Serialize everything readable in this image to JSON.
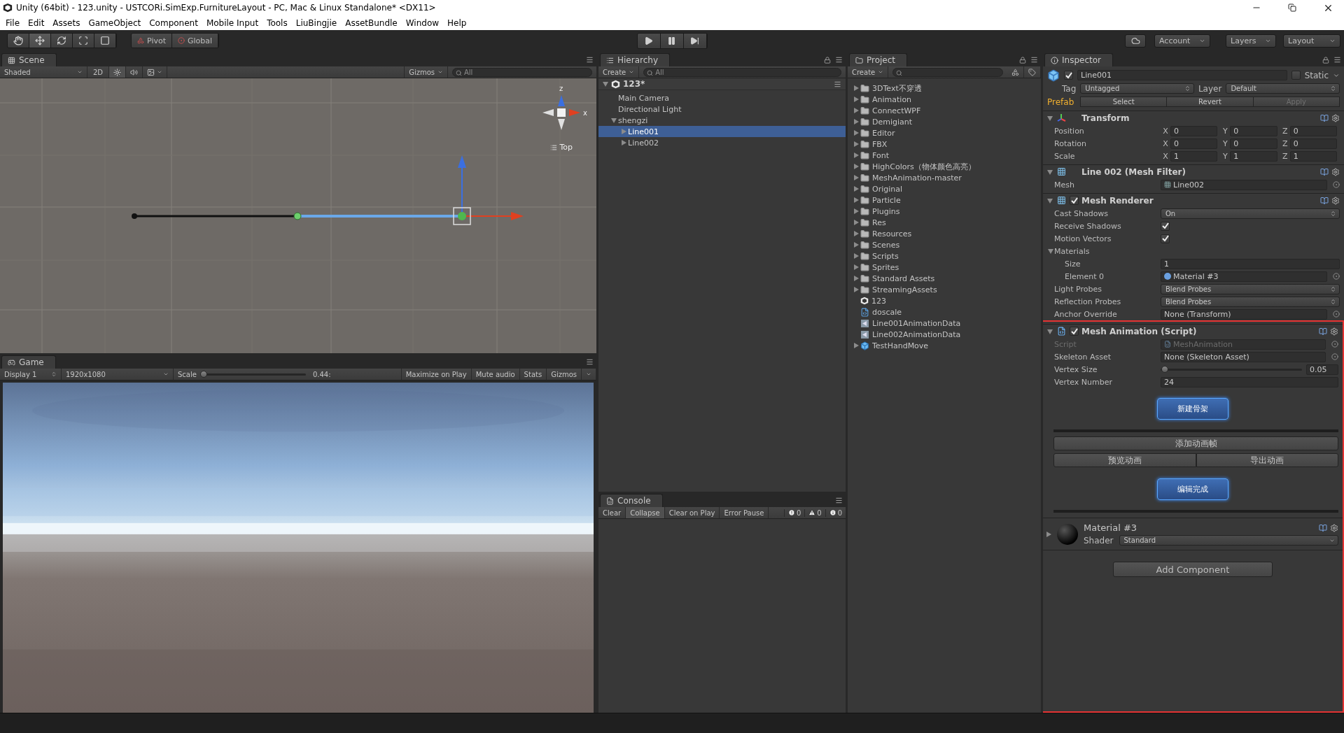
{
  "window": {
    "title": "Unity (64bit) - 123.unity - USTCORi.SimExp.FurnitureLayout - PC, Mac & Linux Standalone* <DX11>"
  },
  "menu": [
    "File",
    "Edit",
    "Assets",
    "GameObject",
    "Component",
    "Mobile Input",
    "Tools",
    "LiuBingjie",
    "AssetBundle",
    "Window",
    "Help"
  ],
  "toolbar": {
    "tools": [
      {
        "kind": "hand",
        "selected": false
      },
      {
        "kind": "move",
        "selected": true
      },
      {
        "kind": "rotate",
        "selected": false
      },
      {
        "kind": "scale",
        "selected": false
      },
      {
        "kind": "rect",
        "selected": false
      }
    ],
    "pivot": "Pivot",
    "global": "Global",
    "playback": [
      {
        "kind": "play"
      },
      {
        "kind": "pause"
      },
      {
        "kind": "step"
      }
    ],
    "account": "Account",
    "layers": "Layers",
    "layout": "Layout"
  },
  "scene": {
    "tab": "Scene",
    "shading": "Shaded",
    "mode": "2D",
    "lighting_on": true,
    "audio_on": false,
    "gizmos": "Gizmos",
    "placeholder": "All",
    "axis_labels": [
      "z",
      "x"
    ],
    "view": "Top"
  },
  "game": {
    "tab": "Game",
    "display": "Display 1",
    "resolution": "1920x1080",
    "scale_label": "Scale",
    "scale": {
      "level": 0.02
    },
    "scale_value": "0.44:",
    "options": [
      "Maximize on Play",
      "Mute audio",
      "Stats",
      "Gizmos"
    ]
  },
  "hierarchy": {
    "tab": "Hierarchy",
    "create": "Create",
    "placeholder": "All",
    "scene": "123*",
    "items": [
      {
        "label": "Main Camera",
        "selected": false
      },
      {
        "label": "Directional Light",
        "selected": false
      },
      {
        "label": "shengzi",
        "selected": false,
        "expanded": true,
        "children": [
          {
            "label": "Line001",
            "selected": true,
            "expanded": false
          },
          {
            "label": "Line002",
            "selected": false,
            "expanded": false
          }
        ]
      }
    ]
  },
  "project": {
    "tab": "Project",
    "create": "Create",
    "items": [
      {
        "kind": "folder",
        "label": "3DText不穿透",
        "expanded": false
      },
      {
        "kind": "folder",
        "label": "Animation",
        "expanded": false
      },
      {
        "kind": "folder",
        "label": "ConnectWPF",
        "expanded": false
      },
      {
        "kind": "folder",
        "label": "Demigiant",
        "expanded": false
      },
      {
        "kind": "folder",
        "label": "Editor",
        "expanded": false
      },
      {
        "kind": "folder",
        "label": "FBX",
        "expanded": false
      },
      {
        "kind": "folder",
        "label": "Font",
        "expanded": false
      },
      {
        "kind": "folder",
        "label": "HighColors（物体颜色高亮）",
        "expanded": false
      },
      {
        "kind": "folder",
        "label": "MeshAnimation-master",
        "expanded": false
      },
      {
        "kind": "folder",
        "label": "Original",
        "expanded": false
      },
      {
        "kind": "folder",
        "label": "Particle",
        "expanded": false
      },
      {
        "kind": "folder",
        "label": "Plugins",
        "expanded": false
      },
      {
        "kind": "folder",
        "label": "Res",
        "expanded": false
      },
      {
        "kind": "folder",
        "label": "Resources",
        "expanded": false
      },
      {
        "kind": "folder",
        "label": "Scenes",
        "expanded": false
      },
      {
        "kind": "folder",
        "label": "Scripts",
        "expanded": false
      },
      {
        "kind": "folder",
        "label": "Sprites",
        "expanded": false
      },
      {
        "kind": "folder",
        "label": "Standard Assets",
        "expanded": false
      },
      {
        "kind": "folder",
        "label": "StreamingAssets",
        "expanded": false
      },
      {
        "kind": "scene",
        "label": "123"
      },
      {
        "kind": "script",
        "label": "doscale"
      },
      {
        "kind": "asset",
        "label": "Line001AnimationData"
      },
      {
        "kind": "asset",
        "label": "Line002AnimationData"
      },
      {
        "kind": "prefab",
        "label": "TestHandMove",
        "expanded": false
      }
    ]
  },
  "console": {
    "tab": "Console",
    "buttons": [
      {
        "label": "Clear",
        "selected": false
      },
      {
        "label": "Collapse",
        "selected": true
      },
      {
        "label": "Clear on Play",
        "selected": false
      },
      {
        "label": "Error Pause",
        "selected": false
      }
    ],
    "counts": [
      {
        "kind": "error",
        "count": "0"
      },
      {
        "kind": "warning",
        "count": "0"
      },
      {
        "kind": "info",
        "count": "0"
      }
    ]
  },
  "inspector": {
    "tab": "Inspector",
    "object": {
      "active": true,
      "name": "Line001",
      "static_label": "Static",
      "static": false,
      "tag_label": "Tag",
      "tag": "Untagged",
      "layer_label": "Layer",
      "layer": "Default",
      "prefab_label": "Prefab",
      "prefab_buttons": [
        {
          "label": "Select",
          "disabled": false
        },
        {
          "label": "Revert",
          "disabled": false
        },
        {
          "label": "Apply",
          "disabled": true
        }
      ]
    },
    "components": [
      {
        "kind": "transform",
        "title": "Transform",
        "expanded": true,
        "highlighted": false,
        "rows": [
          {
            "kind": "vector3",
            "label": "Position",
            "values": [
              {
                "axis": "X",
                "value": "0"
              },
              {
                "axis": "Y",
                "value": "0"
              },
              {
                "axis": "Z",
                "value": "0"
              }
            ]
          },
          {
            "kind": "vector3",
            "label": "Rotation",
            "values": [
              {
                "axis": "X",
                "value": "0"
              },
              {
                "axis": "Y",
                "value": "0"
              },
              {
                "axis": "Z",
                "value": "0"
              }
            ]
          },
          {
            "kind": "vector3",
            "label": "Scale",
            "values": [
              {
                "axis": "X",
                "value": "1"
              },
              {
                "axis": "Y",
                "value": "1"
              },
              {
                "axis": "Z",
                "value": "1"
              }
            ]
          }
        ]
      },
      {
        "kind": "mesh_filter",
        "title": "Line 002 (Mesh Filter)",
        "expanded": true,
        "highlighted": false,
        "rows": [
          {
            "kind": "mesh_object",
            "label": "Mesh",
            "value": "Line002"
          }
        ]
      },
      {
        "kind": "mesh_renderer",
        "title": "Mesh Renderer",
        "enabled": true,
        "expanded": true,
        "highlighted": false,
        "rows": [
          {
            "kind": "dropdown",
            "label": "Cast Shadows",
            "value": "On"
          },
          {
            "kind": "checkbox",
            "label": "Receive Shadows",
            "checked": true
          },
          {
            "kind": "checkbox",
            "label": "Motion Vectors",
            "checked": true
          },
          {
            "kind": "foldout",
            "label": "Materials",
            "expanded": true,
            "children": [
              {
                "kind": "field",
                "label": "Size",
                "value": "1"
              },
              {
                "kind": "material_object",
                "label": "Element 0",
                "value": "Material #3"
              }
            ]
          },
          {
            "kind": "dropdown",
            "label": "Light Probes",
            "value": "Blend Probes"
          },
          {
            "kind": "dropdown",
            "label": "Reflection Probes",
            "value": "Blend Probes"
          },
          {
            "kind": "object",
            "label": "Anchor Override",
            "value": "None (Transform)"
          }
        ]
      },
      {
        "kind": "script",
        "title": "Mesh Animation (Script)",
        "enabled": true,
        "expanded": true,
        "highlighted": true,
        "rows": [
          {
            "kind": "script_object",
            "label": "Script",
            "value": "MeshAnimation",
            "disabled": true
          },
          {
            "kind": "object",
            "label": "Skeleton Asset",
            "value": "None (Skeleton Asset)"
          },
          {
            "kind": "slider",
            "label": "Vertex Size",
            "level": 0.03,
            "value": "0.05"
          },
          {
            "kind": "field",
            "label": "Vertex Number",
            "value": "24"
          },
          {
            "kind": "primary_button",
            "label": "新建骨架"
          },
          {
            "kind": "separator"
          },
          {
            "kind": "button",
            "label": "添加动画帧"
          },
          {
            "kind": "button_pair",
            "labels": [
              "预览动画",
              "导出动画"
            ]
          },
          {
            "kind": "primary_button",
            "label": "编辑完成"
          },
          {
            "kind": "separator"
          }
        ]
      },
      {
        "kind": "material",
        "title": "Material #3",
        "shader_label": "Shader",
        "shader": "Standard",
        "expanded": false,
        "highlighted": true
      }
    ],
    "add_component": {
      "label": "Add Component"
    }
  }
}
